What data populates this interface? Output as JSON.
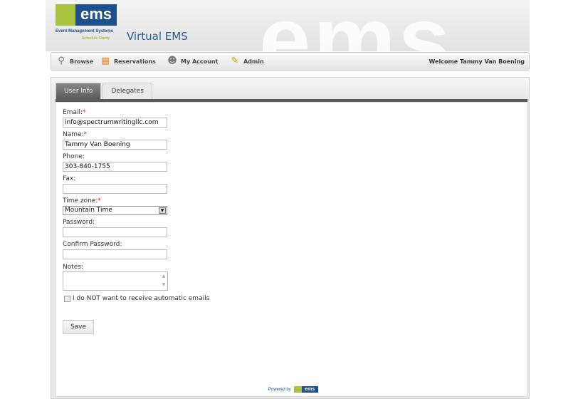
{
  "header": {
    "logo_text": "ems",
    "logo_sub": "Event Management Systems",
    "logo_tagline": "Schedule Clarity",
    "app_title": "Virtual EMS"
  },
  "nav": {
    "items": [
      {
        "label": "Browse",
        "icon": "magnifier-icon"
      },
      {
        "label": "Reservations",
        "icon": "calendar-icon"
      },
      {
        "label": "My Account",
        "icon": "users-icon"
      },
      {
        "label": "Admin",
        "icon": "user-pencil-icon"
      }
    ],
    "welcome": "Welcome Tammy Van Boening"
  },
  "tabs": [
    {
      "label": "User Info",
      "active": true
    },
    {
      "label": "Delegates",
      "active": false
    }
  ],
  "form": {
    "email": {
      "label": "Email:",
      "value": "info@spectrumwritingllc.com",
      "required": "*"
    },
    "name": {
      "label": "Name:",
      "value": "Tammy Van Boening",
      "required": "*"
    },
    "phone": {
      "label": "Phone:",
      "value": "303-840-1755"
    },
    "fax": {
      "label": "Fax:",
      "value": ""
    },
    "timezone": {
      "label": "Time zone:",
      "value": "Mountain Time",
      "required": "*"
    },
    "password": {
      "label": "Password:",
      "value": ""
    },
    "confirm_password": {
      "label": "Confirm Password:",
      "value": ""
    },
    "notes": {
      "label": "Notes:",
      "value": ""
    },
    "no_emails": {
      "label": "I do NOT want to receive automatic emails",
      "checked": false
    },
    "save_label": "Save"
  },
  "footer": {
    "powered_by": "Powered by",
    "logo_text": "ems"
  },
  "colors": {
    "brand_blue": "#1d4f8c",
    "brand_green": "#a9c23f",
    "required": "#e02020"
  }
}
